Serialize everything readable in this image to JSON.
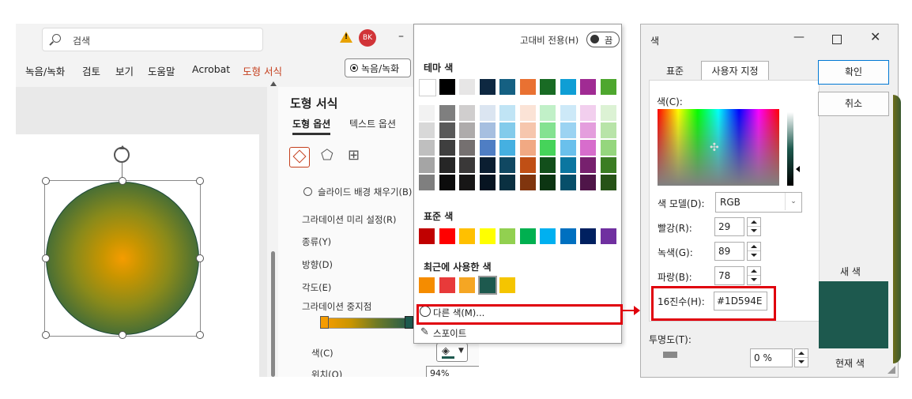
{
  "ppt": {
    "search_placeholder": "검색",
    "avatar": "BK",
    "minimize": "–",
    "menu": [
      "녹음/녹화",
      "검토",
      "보기",
      "도움말",
      "Acrobat",
      "도형 서식"
    ],
    "record_button": "녹음/녹화",
    "pane": {
      "title": "도형 서식",
      "tab_shape": "도형 옵션",
      "tab_text": "텍스트 옵션",
      "slide_bg_fill": "슬라이드 배경 채우기(B)",
      "preset": "그라데이션 미리 설정(R)",
      "type": "종류(Y)",
      "direction": "방향(D)",
      "angle": "각도(E)",
      "stops": "그라데이션 중지점",
      "color": "색(C)",
      "position": "위치(O)",
      "position_value": "94%"
    }
  },
  "dropdown": {
    "high_contrast": "고대비 전용(H)",
    "toggle_state": "끔",
    "theme_title": "테마 색",
    "theme_colors": [
      "#ffffff",
      "#000000",
      "#e7e6e6",
      "#0e2841",
      "#156082",
      "#e97132",
      "#196b24",
      "#0f9ed5",
      "#a02b93",
      "#4ea72e"
    ],
    "theme_shades": [
      [
        "#f2f2f2",
        "#7f7f7f",
        "#d0cece",
        "#dbe5f1",
        "#c0e4f5",
        "#fbe3d6",
        "#c1f0c8",
        "#cde9f8",
        "#f2cfee",
        "#dcf2d4"
      ],
      [
        "#d8d8d8",
        "#595959",
        "#aeabab",
        "#a6bfe0",
        "#83cbeb",
        "#f6c6ad",
        "#84e291",
        "#9bd3f2",
        "#e49edd",
        "#b8e4a8"
      ],
      [
        "#bfbfbf",
        "#3f3f3f",
        "#757070",
        "#4f7ec4",
        "#45b0e1",
        "#f1a983",
        "#46d35a",
        "#6ac0ec",
        "#d76dcc",
        "#95d67d"
      ],
      [
        "#a5a5a5",
        "#262626",
        "#3a3838",
        "#0b1e31",
        "#104862",
        "#c04f15",
        "#124f1b",
        "#0b76a0",
        "#77206e",
        "#3b7d23"
      ],
      [
        "#7f7f7f",
        "#0c0c0c",
        "#171616",
        "#071421",
        "#0a3041",
        "#80350e",
        "#0c3512",
        "#074f6a",
        "#4f1549",
        "#275317"
      ]
    ],
    "standard_title": "표준 색",
    "standard_colors": [
      "#c00000",
      "#ff0000",
      "#ffc000",
      "#ffff00",
      "#92d050",
      "#00b050",
      "#00b0f0",
      "#0070c0",
      "#002060",
      "#7030a0"
    ],
    "recent_title": "최근에 사용한 색",
    "recent_colors": [
      "#f58c00",
      "#e83a3a",
      "#f5a623",
      "#1d594e",
      "#f5c500"
    ],
    "more_colors": "다른 색(M)...",
    "eyedropper": "스포이트"
  },
  "dialog": {
    "title": "색",
    "tab_standard": "표준",
    "tab_custom": "사용자 지정",
    "colors_label": "색(C):",
    "ok": "확인",
    "cancel": "취소",
    "color_model_label": "색 모델(D):",
    "color_model": "RGB",
    "red_label": "빨강(R):",
    "red": "29",
    "green_label": "녹색(G):",
    "green": "89",
    "blue_label": "파랑(B):",
    "blue": "78",
    "hex_label": "16진수(H):",
    "hex": "#1D594E",
    "transparency_label": "투명도(T):",
    "transparency": "0 %",
    "new_label": "새 색",
    "current_label": "현재 색",
    "new_color": "#1d594e"
  }
}
